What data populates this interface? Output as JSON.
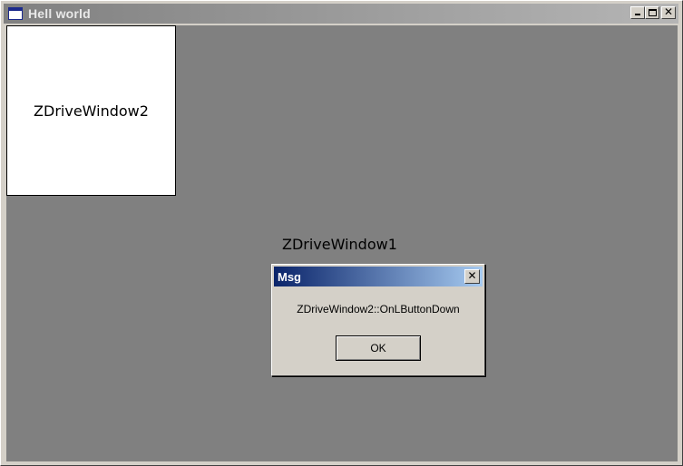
{
  "window": {
    "title": "Hell world",
    "icon": "application-window-icon",
    "minimize_icon": "minimize-icon",
    "maximize_icon": "maximize-icon",
    "close_glyph": "✕"
  },
  "client": {
    "child_window2_label": "ZDriveWindow2",
    "child_window1_label": "ZDriveWindow1",
    "background_color": "#808080"
  },
  "dialog": {
    "title": "Msg",
    "close_glyph": "✕",
    "message": "ZDriveWindow2::OnLButtonDown",
    "ok_label": "OK",
    "title_gradient_start": "#0a246a",
    "title_gradient_end": "#a6caf0"
  }
}
